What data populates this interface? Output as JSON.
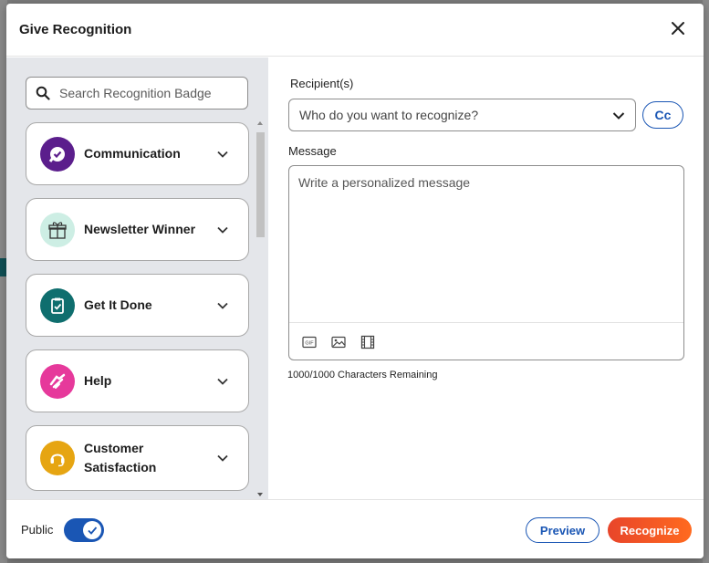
{
  "dialog": {
    "title": "Give Recognition",
    "close_icon": "close-icon"
  },
  "search": {
    "placeholder": "Search Recognition Badge",
    "icon": "search-icon"
  },
  "badges": [
    {
      "label": "Communication",
      "icon": "chat-check-icon",
      "color": "#5b1e8c"
    },
    {
      "label": "Newsletter Winner",
      "icon": "gift-box-icon",
      "color": "#cdeee4"
    },
    {
      "label": "Get It Done",
      "icon": "clipboard-check-icon",
      "color": "#0f6e6e"
    },
    {
      "label": "Help",
      "icon": "handshake-icon",
      "color": "#e6399b"
    },
    {
      "label": "Customer Satisfaction",
      "icon": "headset-icon",
      "color": "#e6a512"
    }
  ],
  "recipients": {
    "label": "Recipient(s)",
    "placeholder": "Who do you want to recognize?",
    "cc_label": "Cc"
  },
  "message": {
    "label": "Message",
    "placeholder": "Write a personalized message",
    "tools": [
      "gif-icon",
      "image-icon",
      "video-icon"
    ],
    "remaining": "1000/1000 Characters Remaining"
  },
  "footer": {
    "public_label": "Public",
    "public_on": true,
    "preview_label": "Preview",
    "recognize_label": "Recognize"
  },
  "colors": {
    "accent": "#1a56b4",
    "recognize_start": "#e8452a",
    "recognize_end": "#ff6a1f"
  }
}
